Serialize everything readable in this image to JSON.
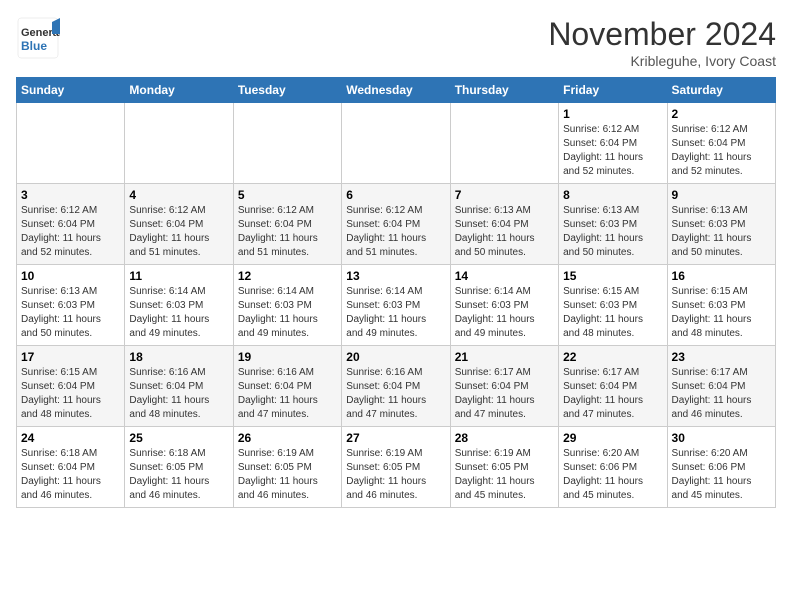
{
  "header": {
    "logo_general": "General",
    "logo_blue": "Blue",
    "month_title": "November 2024",
    "location": "Kribleguhe, Ivory Coast"
  },
  "days_of_week": [
    "Sunday",
    "Monday",
    "Tuesday",
    "Wednesday",
    "Thursday",
    "Friday",
    "Saturday"
  ],
  "weeks": [
    {
      "days": [
        {
          "num": "",
          "info": ""
        },
        {
          "num": "",
          "info": ""
        },
        {
          "num": "",
          "info": ""
        },
        {
          "num": "",
          "info": ""
        },
        {
          "num": "",
          "info": ""
        },
        {
          "num": "1",
          "info": "Sunrise: 6:12 AM\nSunset: 6:04 PM\nDaylight: 11 hours\nand 52 minutes."
        },
        {
          "num": "2",
          "info": "Sunrise: 6:12 AM\nSunset: 6:04 PM\nDaylight: 11 hours\nand 52 minutes."
        }
      ]
    },
    {
      "days": [
        {
          "num": "3",
          "info": "Sunrise: 6:12 AM\nSunset: 6:04 PM\nDaylight: 11 hours\nand 52 minutes."
        },
        {
          "num": "4",
          "info": "Sunrise: 6:12 AM\nSunset: 6:04 PM\nDaylight: 11 hours\nand 51 minutes."
        },
        {
          "num": "5",
          "info": "Sunrise: 6:12 AM\nSunset: 6:04 PM\nDaylight: 11 hours\nand 51 minutes."
        },
        {
          "num": "6",
          "info": "Sunrise: 6:12 AM\nSunset: 6:04 PM\nDaylight: 11 hours\nand 51 minutes."
        },
        {
          "num": "7",
          "info": "Sunrise: 6:13 AM\nSunset: 6:04 PM\nDaylight: 11 hours\nand 50 minutes."
        },
        {
          "num": "8",
          "info": "Sunrise: 6:13 AM\nSunset: 6:03 PM\nDaylight: 11 hours\nand 50 minutes."
        },
        {
          "num": "9",
          "info": "Sunrise: 6:13 AM\nSunset: 6:03 PM\nDaylight: 11 hours\nand 50 minutes."
        }
      ]
    },
    {
      "days": [
        {
          "num": "10",
          "info": "Sunrise: 6:13 AM\nSunset: 6:03 PM\nDaylight: 11 hours\nand 50 minutes."
        },
        {
          "num": "11",
          "info": "Sunrise: 6:14 AM\nSunset: 6:03 PM\nDaylight: 11 hours\nand 49 minutes."
        },
        {
          "num": "12",
          "info": "Sunrise: 6:14 AM\nSunset: 6:03 PM\nDaylight: 11 hours\nand 49 minutes."
        },
        {
          "num": "13",
          "info": "Sunrise: 6:14 AM\nSunset: 6:03 PM\nDaylight: 11 hours\nand 49 minutes."
        },
        {
          "num": "14",
          "info": "Sunrise: 6:14 AM\nSunset: 6:03 PM\nDaylight: 11 hours\nand 49 minutes."
        },
        {
          "num": "15",
          "info": "Sunrise: 6:15 AM\nSunset: 6:03 PM\nDaylight: 11 hours\nand 48 minutes."
        },
        {
          "num": "16",
          "info": "Sunrise: 6:15 AM\nSunset: 6:03 PM\nDaylight: 11 hours\nand 48 minutes."
        }
      ]
    },
    {
      "days": [
        {
          "num": "17",
          "info": "Sunrise: 6:15 AM\nSunset: 6:04 PM\nDaylight: 11 hours\nand 48 minutes."
        },
        {
          "num": "18",
          "info": "Sunrise: 6:16 AM\nSunset: 6:04 PM\nDaylight: 11 hours\nand 48 minutes."
        },
        {
          "num": "19",
          "info": "Sunrise: 6:16 AM\nSunset: 6:04 PM\nDaylight: 11 hours\nand 47 minutes."
        },
        {
          "num": "20",
          "info": "Sunrise: 6:16 AM\nSunset: 6:04 PM\nDaylight: 11 hours\nand 47 minutes."
        },
        {
          "num": "21",
          "info": "Sunrise: 6:17 AM\nSunset: 6:04 PM\nDaylight: 11 hours\nand 47 minutes."
        },
        {
          "num": "22",
          "info": "Sunrise: 6:17 AM\nSunset: 6:04 PM\nDaylight: 11 hours\nand 47 minutes."
        },
        {
          "num": "23",
          "info": "Sunrise: 6:17 AM\nSunset: 6:04 PM\nDaylight: 11 hours\nand 46 minutes."
        }
      ]
    },
    {
      "days": [
        {
          "num": "24",
          "info": "Sunrise: 6:18 AM\nSunset: 6:04 PM\nDaylight: 11 hours\nand 46 minutes."
        },
        {
          "num": "25",
          "info": "Sunrise: 6:18 AM\nSunset: 6:05 PM\nDaylight: 11 hours\nand 46 minutes."
        },
        {
          "num": "26",
          "info": "Sunrise: 6:19 AM\nSunset: 6:05 PM\nDaylight: 11 hours\nand 46 minutes."
        },
        {
          "num": "27",
          "info": "Sunrise: 6:19 AM\nSunset: 6:05 PM\nDaylight: 11 hours\nand 46 minutes."
        },
        {
          "num": "28",
          "info": "Sunrise: 6:19 AM\nSunset: 6:05 PM\nDaylight: 11 hours\nand 45 minutes."
        },
        {
          "num": "29",
          "info": "Sunrise: 6:20 AM\nSunset: 6:06 PM\nDaylight: 11 hours\nand 45 minutes."
        },
        {
          "num": "30",
          "info": "Sunrise: 6:20 AM\nSunset: 6:06 PM\nDaylight: 11 hours\nand 45 minutes."
        }
      ]
    }
  ]
}
